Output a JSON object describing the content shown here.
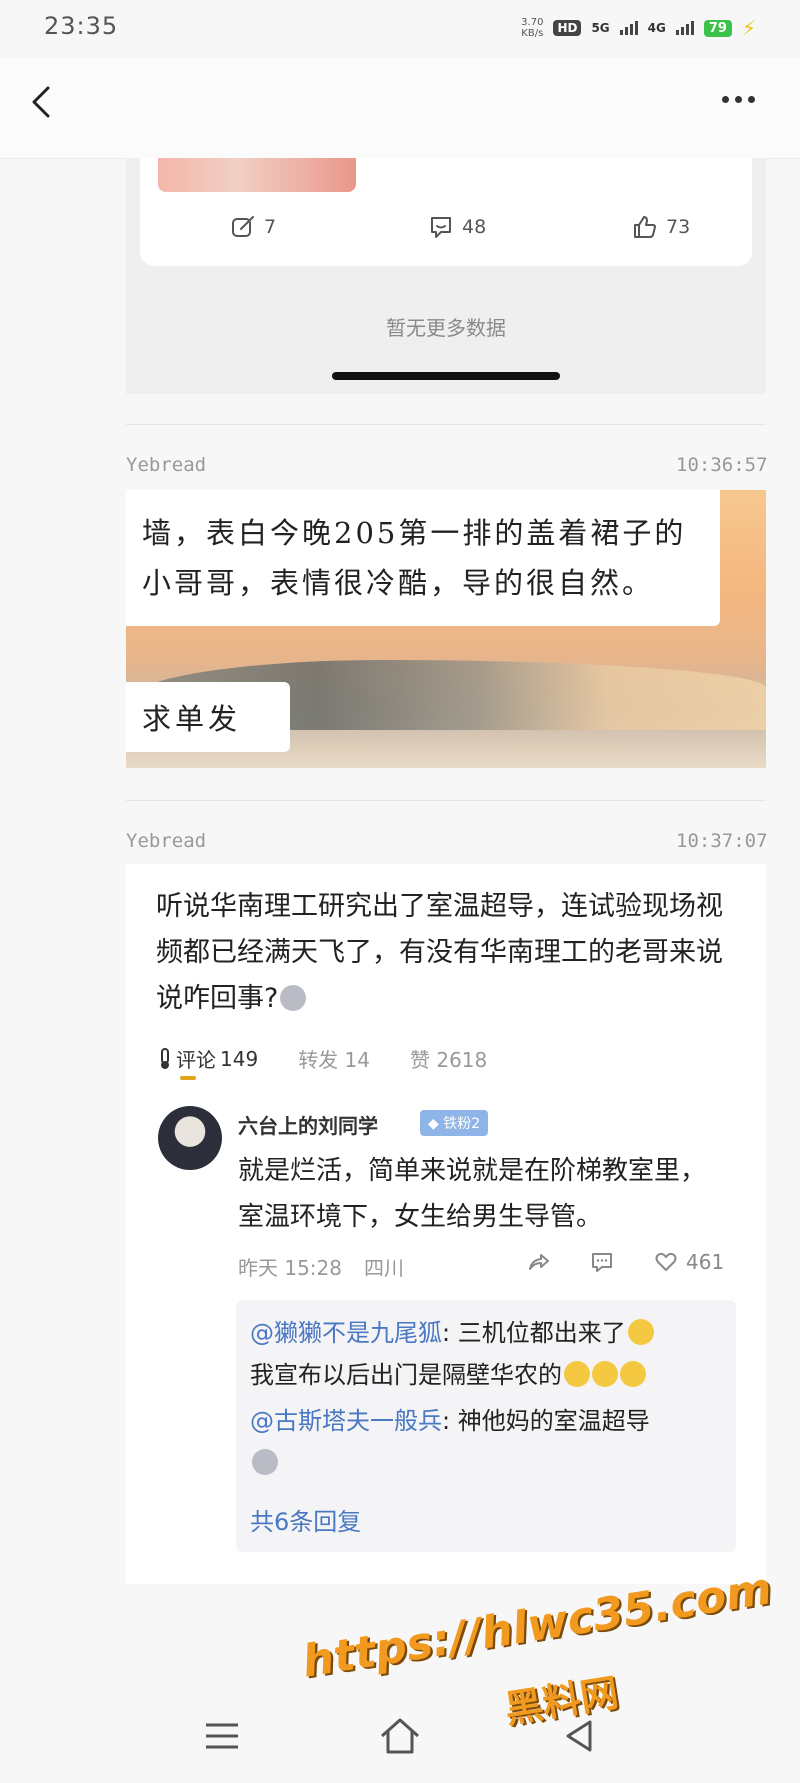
{
  "status_bar": {
    "time": "23:35",
    "speed_value": "3.70",
    "speed_unit": "KB/s",
    "hd": "HD",
    "net1": "5G",
    "net2": "4G",
    "battery": "79"
  },
  "post1": {
    "repost_count": "7",
    "comment_count": "48",
    "like_count": "73",
    "no_more": "暂无更多数据"
  },
  "item2": {
    "source": "Yebread",
    "time": "10:36:57",
    "bubble_main": "墙，表白今晚205第一排的盖着裙子的小哥哥，表情很冷酷，导的很自然。",
    "bubble_small": "求单发"
  },
  "item3": {
    "source": "Yebread",
    "time": "10:37:07",
    "post_text": "听说华南理工研究出了室温超导，连试验现场视频都已经满天飞了，有没有华南理工的老哥来说说咋回事?",
    "stats": {
      "comments_label": "评论",
      "comments": "149",
      "reposts_label": "转发",
      "reposts": "14",
      "likes_label": "赞",
      "likes": "2618"
    },
    "comment": {
      "user": "六台上的刘同学",
      "badge": "铁粉2",
      "text": "就是烂活，简单来说就是在阶梯教室里，室温环境下，女生给男生导管。",
      "time": "昨天 15:28",
      "location": "四川",
      "likes": "461"
    },
    "replies": [
      {
        "user": "@獭獭不是九尾狐",
        "text": ": 三机位都出来了",
        "text2": "我宣布以后出门是隔壁华农的"
      },
      {
        "user": "@古斯塔夫一般兵",
        "text": ": 神他妈的室温超导"
      }
    ],
    "reply_count": "共6条回复"
  },
  "watermark": {
    "url": "https://hlwc35.com",
    "name": "黑料网"
  },
  "colors": {
    "mention": "#4a78c2",
    "battery": "#3cc24a",
    "watermark": "#f29a1f"
  }
}
